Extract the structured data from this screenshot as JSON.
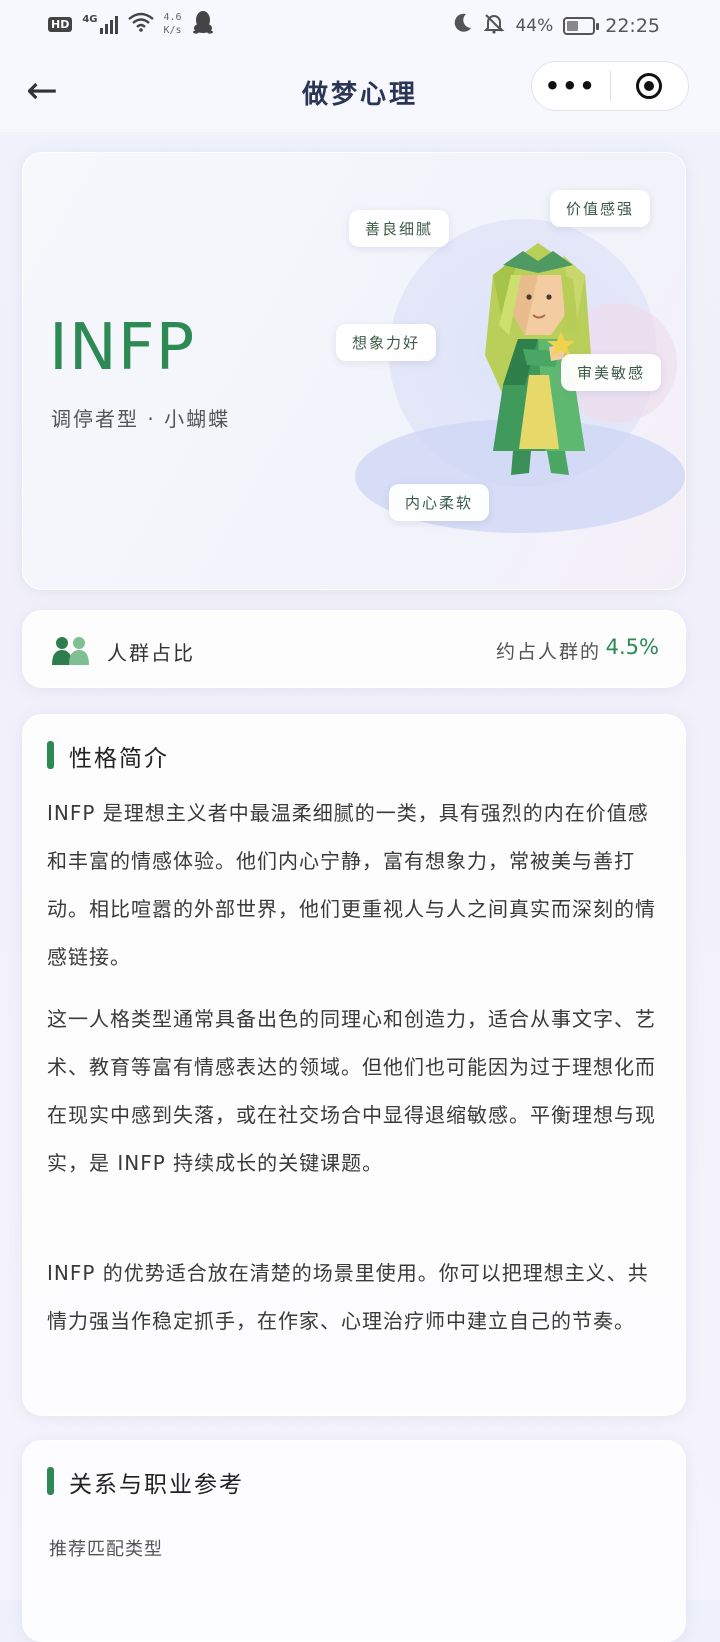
{
  "status_bar": {
    "hd": "HD",
    "network_type": "4G",
    "net_speed_value": "4.6",
    "net_speed_unit": "K/s",
    "battery": "44%",
    "battery_level": 0.44,
    "time": "22:25"
  },
  "nav": {
    "back_glyph": "←",
    "title": "做梦心理",
    "more_glyph": "•••"
  },
  "hero": {
    "type_code": "INFP",
    "type_subtitle": "调停者型 · 小蝴蝶",
    "tags": [
      "善良细腻",
      "价值感强",
      "想象力好",
      "审美敏感",
      "内心柔软"
    ]
  },
  "ratio": {
    "label": "人群占比",
    "prefix": "约占人群的",
    "value": "4.5%"
  },
  "intro": {
    "title": "性格简介",
    "paragraphs": [
      "INFP 是理想主义者中最温柔细腻的一类，具有强烈的内在价值感和丰富的情感体验。他们内心宁静，富有想象力，常被美与善打动。相比喧嚣的外部世界，他们更重视人与人之间真实而深刻的情感链接。",
      "这一人格类型通常具备出色的同理心和创造力，适合从事文字、艺术、教育等富有情感表达的领域。但他们也可能因为过于理想化而在现实中感到失落，或在社交场合中显得退缩敏感。平衡理想与现实，是 INFP 持续成长的关键课题。",
      "INFP 的优势适合放在清楚的场景里使用。你可以把理想主义、共情力强当作稳定抓手，在作家、心理治疗师中建立自己的节奏。"
    ]
  },
  "relations": {
    "title": "关系与职业参考",
    "recommended_label": "推荐匹配类型"
  },
  "colors": {
    "accent": "#2e8a55",
    "title_navy": "#2b3556"
  },
  "icons": {
    "signal": "signal-icon",
    "wifi": "wifi-icon",
    "qq": "penguin-icon",
    "moon": "moon-icon",
    "mute": "bell-off-icon",
    "people": "people-icon",
    "close": "target-icon"
  }
}
